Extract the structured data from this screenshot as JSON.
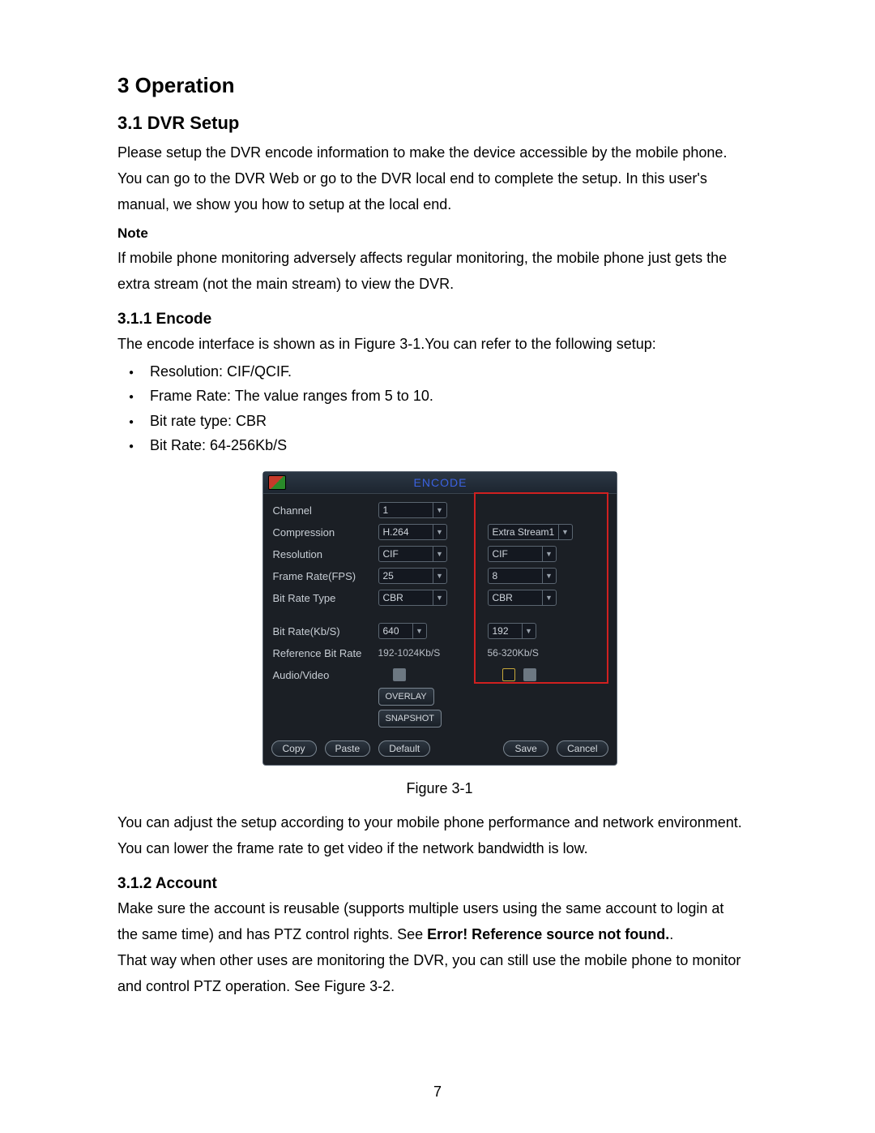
{
  "page_number": "7",
  "h1": "3  Operation",
  "h2": "3.1  DVR Setup",
  "para1a": "Please setup the DVR encode information to make the device accessible by the mobile phone.",
  "para1b": "You can go to the DVR Web or go to the DVR local end to complete the setup. In this user's",
  "para1c": "manual, we show you how to setup at the local end.",
  "note_label": "Note",
  "note1": "If mobile phone monitoring adversely affects regular monitoring, the mobile phone just gets the",
  "note2": "extra stream (not the main stream) to view the DVR.",
  "h3a": "3.1.1   Encode",
  "enc_intro": "The encode interface is shown as in Figure 3-1.You can refer to the following setup:",
  "bullets": {
    "b0": "Resolution: CIF/QCIF.",
    "b1": "Frame Rate: The value ranges from 5 to 10.",
    "b2": "Bit rate type: CBR",
    "b3": "Bit Rate: 64-256Kb/S"
  },
  "caption1": "Figure 3-1",
  "post1a": "You can adjust the setup according to your mobile phone performance and network environment.",
  "post1b": "You can lower the frame rate to get video if the network bandwidth is low.",
  "h3b": "3.1.2   Account",
  "acc1": "Make sure the account is reusable (supports multiple users using the same account to login at",
  "acc2a": "the same time) and has PTZ control rights.  See ",
  "acc2b": "Error! Reference source not found.",
  "acc2c": ".",
  "acc3": "That way when other uses are monitoring the DVR, you can still use the mobile phone to monitor",
  "acc4": "and control PTZ operation. See Figure 3-2.",
  "dlg": {
    "title": "ENCODE",
    "labels": {
      "channel": "Channel",
      "compression": "Compression",
      "resolution": "Resolution",
      "fps": "Frame Rate(FPS)",
      "brtype": "Bit Rate Type",
      "bitrate": "Bit Rate(Kb/S)",
      "refrate": "Reference Bit Rate",
      "av": "Audio/Video"
    },
    "main": {
      "channel": "1",
      "compression": "H.264",
      "resolution": "CIF",
      "fps": "25",
      "brtype": "CBR",
      "bitrate": "640",
      "refrate": "192-1024Kb/S"
    },
    "extra": {
      "stream": "Extra Stream1",
      "resolution": "CIF",
      "fps": "8",
      "brtype": "CBR",
      "bitrate": "192",
      "refrate": "56-320Kb/S"
    },
    "overlay_btn": "OVERLAY",
    "snapshot_btn": "SNAPSHOT",
    "buttons": {
      "copy": "Copy",
      "paste": "Paste",
      "default": "Default",
      "save": "Save",
      "cancel": "Cancel"
    }
  }
}
